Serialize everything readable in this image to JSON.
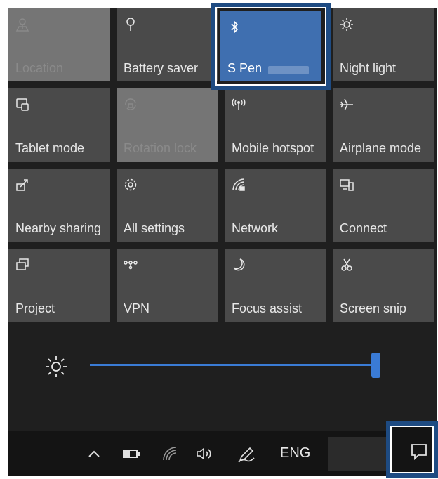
{
  "action_center": {
    "tiles": [
      {
        "label": "Location",
        "icon": "location-icon",
        "state": "disabled"
      },
      {
        "label": "Battery saver",
        "icon": "battery-saver-icon",
        "state": "off"
      },
      {
        "label": "S Pen",
        "icon": "bluetooth-icon",
        "state": "on"
      },
      {
        "label": "Night light",
        "icon": "night-light-icon",
        "state": "off"
      },
      {
        "label": "Tablet mode",
        "icon": "tablet-mode-icon",
        "state": "off"
      },
      {
        "label": "Rotation lock",
        "icon": "rotation-lock-icon",
        "state": "disabled"
      },
      {
        "label": "Mobile hotspot",
        "icon": "mobile-hotspot-icon",
        "state": "off"
      },
      {
        "label": "Airplane mode",
        "icon": "airplane-icon",
        "state": "off"
      },
      {
        "label": "Nearby sharing",
        "icon": "nearby-sharing-icon",
        "state": "off"
      },
      {
        "label": "All settings",
        "icon": "settings-gear-icon",
        "state": "off"
      },
      {
        "label": "Network",
        "icon": "network-icon",
        "state": "off"
      },
      {
        "label": "Connect",
        "icon": "connect-icon",
        "state": "off"
      },
      {
        "label": "Project",
        "icon": "project-icon",
        "state": "off"
      },
      {
        "label": "VPN",
        "icon": "vpn-icon",
        "state": "off"
      },
      {
        "label": "Focus assist",
        "icon": "moon-icon",
        "state": "off"
      },
      {
        "label": "Screen snip",
        "icon": "screen-snip-icon",
        "state": "off"
      }
    ],
    "brightness": {
      "level": 1.0,
      "icon": "brightness-sun-icon"
    }
  },
  "taskbar": {
    "language": "ENG",
    "icons": [
      "chevron-up-icon",
      "battery-icon",
      "wifi-icon",
      "volume-icon",
      "pen-icon"
    ],
    "notification_icon": "notification-icon"
  },
  "colors": {
    "tile": "#4a4a4a",
    "tile_active": "#3f6fb0",
    "accent": "#3a7bd5",
    "highlight": "#1e4b82"
  }
}
